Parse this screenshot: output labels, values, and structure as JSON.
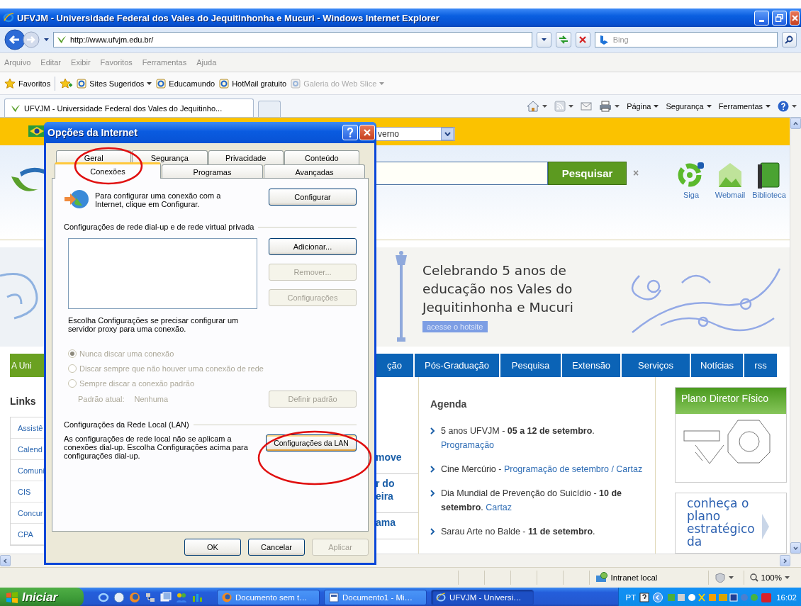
{
  "window": {
    "title": "UFVJM - Universidade Federal dos Vales do Jequitinhonha e Mucuri - Windows Internet Explorer"
  },
  "address_bar": {
    "url": "http://www.ufvjm.edu.br/",
    "search_placeholder": "Bing"
  },
  "menu_bar": [
    "Arquivo",
    "Editar",
    "Exibir",
    "Favoritos",
    "Ferramentas",
    "Ajuda"
  ],
  "favorites_bar": {
    "label": "Favoritos",
    "items": [
      {
        "label": "Sites Sugeridos",
        "dropdown": true,
        "disabled": false
      },
      {
        "label": "Educamundo",
        "dropdown": false,
        "disabled": false
      },
      {
        "label": "HotMail gratuito",
        "dropdown": false,
        "disabled": false
      },
      {
        "label": "Galeria do Web Slice",
        "dropdown": true,
        "disabled": true
      }
    ]
  },
  "browser_tabs": [
    {
      "label": "UFVJM - Universidade Federal dos Vales do Jequitinho...",
      "selected": true
    }
  ],
  "command_bar": [
    "Página",
    "Segurança",
    "Ferramentas"
  ],
  "page": {
    "state_select": {
      "value": "verno"
    },
    "search": {
      "button": "Pesquisar",
      "clear": "×"
    },
    "services": [
      "Siga",
      "Webmail",
      "Biblioteca"
    ],
    "banner": {
      "lines": [
        "Celebrando 5 anos de",
        "educação nos Vales do",
        "Jequitinhonha e Mucuri"
      ],
      "button": "acesse o hotsite"
    },
    "nav": [
      {
        "label": "A Uni",
        "color": "#6aa121"
      },
      {
        "label": "ção",
        "color": "#0b63b6"
      },
      {
        "label": "Pós-Graduação",
        "color": "#0b63b6"
      },
      {
        "label": "Pesquisa",
        "color": "#0b63b6"
      },
      {
        "label": "Extensão",
        "color": "#0b63b6"
      },
      {
        "label": "Serviços",
        "color": "#0b63b6"
      },
      {
        "label": "Notícias",
        "color": "#0b63b6"
      },
      {
        "label": "rss",
        "color": "#0b63b6"
      }
    ],
    "links": {
      "title": "Links",
      "items": [
        "Assistê",
        "Calend",
        "Comuni",
        "CIS",
        "Concur",
        "CPA"
      ]
    },
    "news_fragments": [
      [
        "move"
      ],
      [
        "r do",
        "eira"
      ],
      [
        "ama"
      ]
    ],
    "agenda": {
      "title": "Agenda",
      "items": [
        {
          "text": "5 anos UFVJM - **05 a 12 de setembro**.",
          "links": [
            "Programação"
          ]
        },
        {
          "text": "Cine Mercúrio -",
          "links": [
            "Programação de setembro / Cartaz"
          ]
        },
        {
          "text": "Dia Mundial de Prevenção do Suicídio - **10 de setembro**.",
          "links": [
            "Cartaz"
          ]
        },
        {
          "text": "Sarau Arte no Balde - **11 de setembro**."
        }
      ]
    },
    "plan_card": {
      "title": "Plano Diretor Físico"
    },
    "strategy_card": {
      "lines": [
        "conheça o",
        "plano",
        "estratégico",
        "da"
      ]
    }
  },
  "dialog": {
    "title": "Opções da Internet",
    "tab_rows": [
      [
        {
          "label": "Geral",
          "selected": false
        },
        {
          "label": "Segurança",
          "selected": false
        },
        {
          "label": "Privacidade",
          "selected": false
        },
        {
          "label": "Conteúdo",
          "selected": false
        }
      ],
      [
        {
          "label": "Conexões",
          "selected": true
        },
        {
          "label": "Programas",
          "selected": false
        },
        {
          "label": "Avançadas",
          "selected": false
        }
      ]
    ],
    "setup": {
      "text": "Para configurar uma conexão com a Internet, clique em Configurar.",
      "button": "Configurar"
    },
    "dialup": {
      "heading": "Configurações de rede dial-up e de rede virtual privada",
      "buttons": [
        {
          "label": "Adicionar...",
          "disabled": false
        },
        {
          "label": "Remover...",
          "disabled": true
        },
        {
          "label": "Configurações",
          "disabled": true
        }
      ],
      "hint": "Escolha Configurações se precisar configurar um servidor proxy para uma conexão.",
      "options": [
        {
          "label": "Nunca discar uma conexão",
          "selected": true,
          "disabled": true
        },
        {
          "label": "Discar sempre que não houver uma conexão de rede",
          "selected": false,
          "disabled": true
        },
        {
          "label": "Sempre discar a conexão padrão",
          "selected": false,
          "disabled": true
        }
      ],
      "default_label": "Padrão atual:",
      "default_value": "Nenhuma",
      "default_button": {
        "label": "Definir padrão",
        "disabled": true
      }
    },
    "lan": {
      "heading": "Configurações da Rede Local (LAN)",
      "text": "As configurações de rede local não se aplicam a conexões dial-up. Escolha Configurações acima para configurações dial-up.",
      "button": {
        "label": "Configurações da LAN",
        "highlighted": true
      }
    },
    "buttons": [
      {
        "label": "OK",
        "disabled": false
      },
      {
        "label": "Cancelar",
        "disabled": false
      },
      {
        "label": "Aplicar",
        "disabled": true
      }
    ]
  },
  "status_bar": {
    "zone": "Intranet local",
    "zoom": "100%"
  },
  "taskbar": {
    "start": "Iniciar",
    "tasks": [
      {
        "label": "Documento sem t…",
        "selected": false
      },
      {
        "label": "Documento1 - Mi…",
        "selected": false
      },
      {
        "label": "UFVJM - Universi…",
        "selected": true
      }
    ],
    "language": "PT",
    "clock": "16:02"
  }
}
